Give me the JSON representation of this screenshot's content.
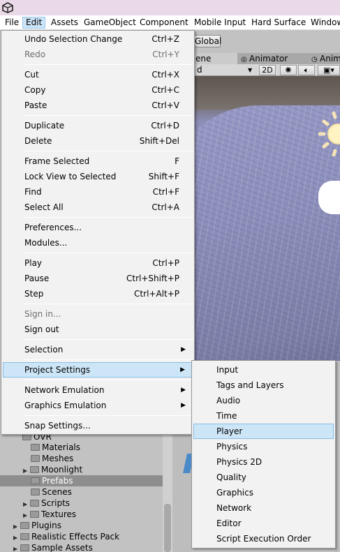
{
  "menubar": {
    "items": [
      "File",
      "Edit",
      "Assets",
      "GameObject",
      "Component",
      "Mobile Input",
      "Hard Surface",
      "Window"
    ],
    "active": "Edit"
  },
  "toolbar": {
    "global_label": "Global"
  },
  "tabs": {
    "scene": "ene",
    "animator": "Animator",
    "animation": "Anim"
  },
  "scene_toolbar": {
    "shading_fragment": "d",
    "mode_2d": "2D"
  },
  "edit_menu": {
    "items": [
      {
        "label": "Undo Selection Change",
        "shortcut": "Ctrl+Z",
        "disabled": false
      },
      {
        "label": "Redo",
        "shortcut": "Ctrl+Y",
        "disabled": true
      },
      {
        "label": "Cut",
        "shortcut": "Ctrl+X",
        "disabled": false
      },
      {
        "label": "Copy",
        "shortcut": "Ctrl+C",
        "disabled": false
      },
      {
        "label": "Paste",
        "shortcut": "Ctrl+V",
        "disabled": false
      },
      {
        "label": "Duplicate",
        "shortcut": "Ctrl+D",
        "disabled": false
      },
      {
        "label": "Delete",
        "shortcut": "Shift+Del",
        "disabled": false
      },
      {
        "label": "Frame Selected",
        "shortcut": "F",
        "disabled": false
      },
      {
        "label": "Lock View to Selected",
        "shortcut": "Shift+F",
        "disabled": false
      },
      {
        "label": "Find",
        "shortcut": "Ctrl+F",
        "disabled": false
      },
      {
        "label": "Select All",
        "shortcut": "Ctrl+A",
        "disabled": false
      },
      {
        "label": "Preferences...",
        "shortcut": "",
        "disabled": false
      },
      {
        "label": "Modules...",
        "shortcut": "",
        "disabled": false
      },
      {
        "label": "Play",
        "shortcut": "Ctrl+P",
        "disabled": false
      },
      {
        "label": "Pause",
        "shortcut": "Ctrl+Shift+P",
        "disabled": false
      },
      {
        "label": "Step",
        "shortcut": "Ctrl+Alt+P",
        "disabled": false
      },
      {
        "label": "Sign in...",
        "shortcut": "",
        "disabled": true
      },
      {
        "label": "Sign out",
        "shortcut": "",
        "disabled": false
      },
      {
        "label": "Selection",
        "shortcut": "",
        "disabled": false,
        "submenu": true
      },
      {
        "label": "Project Settings",
        "shortcut": "",
        "disabled": false,
        "submenu": true,
        "highlighted": true
      },
      {
        "label": "Network Emulation",
        "shortcut": "",
        "disabled": false,
        "submenu": true
      },
      {
        "label": "Graphics Emulation",
        "shortcut": "",
        "disabled": false,
        "submenu": true
      },
      {
        "label": "Snap Settings...",
        "shortcut": "",
        "disabled": false
      }
    ]
  },
  "project_settings_menu": {
    "items": [
      "Input",
      "Tags and Layers",
      "Audio",
      "Time",
      "Player",
      "Physics",
      "Physics 2D",
      "Quality",
      "Graphics",
      "Network",
      "Editor",
      "Script Execution Order"
    ],
    "highlighted": "Player"
  },
  "project_tree": {
    "rows": [
      {
        "label": "OVR",
        "arrow": "",
        "selected": false
      },
      {
        "label": "Materials",
        "arrow": "",
        "selected": false
      },
      {
        "label": "Meshes",
        "arrow": "",
        "selected": false
      },
      {
        "label": "Moonlight",
        "arrow": "▶",
        "selected": false
      },
      {
        "label": "Prefabs",
        "arrow": "",
        "selected": true
      },
      {
        "label": "Scenes",
        "arrow": "",
        "selected": false
      },
      {
        "label": "Scripts",
        "arrow": "▶",
        "selected": false
      },
      {
        "label": "Textures",
        "arrow": "▶",
        "selected": false
      },
      {
        "label": "Plugins",
        "arrow": "▶",
        "selected": false
      },
      {
        "label": "Realistic Effects Pack",
        "arrow": "▶",
        "selected": false
      },
      {
        "label": "Sample Assets",
        "arrow": "▶",
        "selected": false
      }
    ]
  }
}
